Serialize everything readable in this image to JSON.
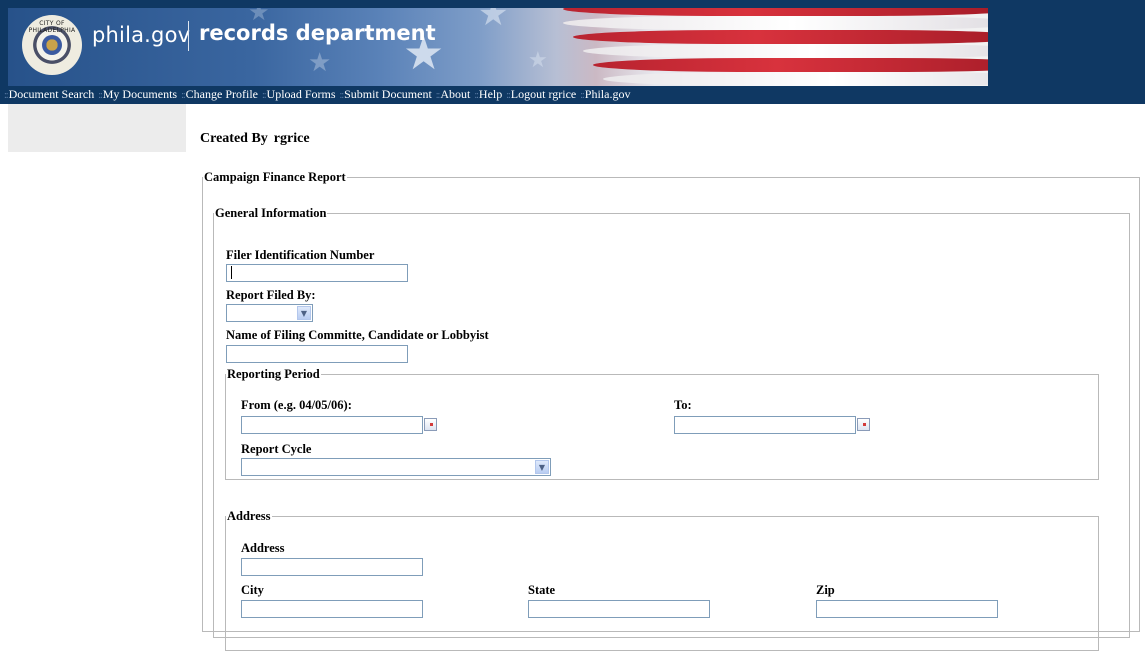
{
  "header": {
    "site": "phila.gov",
    "department": "records department",
    "seal_text": "CITY OF PHILADELPHIA"
  },
  "nav": [
    {
      "label": "Document Search"
    },
    {
      "label": "My Documents"
    },
    {
      "label": "Change Profile"
    },
    {
      "label": "Upload Forms"
    },
    {
      "label": "Submit Document"
    },
    {
      "label": "About"
    },
    {
      "label": "Help"
    },
    {
      "label": "Logout rgrice"
    },
    {
      "label": "Phila.gov"
    }
  ],
  "page": {
    "created_by_label": "Created By",
    "created_by_user": "rgrice"
  },
  "form": {
    "legend": "Campaign Finance Report",
    "general": {
      "legend": "General Information",
      "filer_id_label": "Filer Identification Number",
      "filer_id_value": "",
      "report_filed_by_label": "Report Filed By:",
      "report_filed_by_value": "",
      "name_label": "Name of Filing Committe, Candidate or Lobbyist",
      "name_value": ""
    },
    "period": {
      "legend": "Reporting Period",
      "from_label": "From (e.g. 04/05/06):",
      "from_value": "",
      "to_label": "To:",
      "to_value": "",
      "cycle_label": "Report Cycle",
      "cycle_value": ""
    },
    "address": {
      "legend": "Address",
      "address_label": "Address",
      "address_value": "",
      "city_label": "City",
      "city_value": "",
      "state_label": "State",
      "state_value": "",
      "zip_label": "Zip",
      "zip_value": ""
    }
  },
  "colors": {
    "header_bg": "#0f3863",
    "nav_text": "#ffffff",
    "input_border": "#7f9db9",
    "fieldset_border": "#b9b9b9"
  },
  "icons": {
    "seal": "city-seal-icon",
    "calendar": "calendar-icon",
    "dropdown": "chevron-down-icon"
  }
}
